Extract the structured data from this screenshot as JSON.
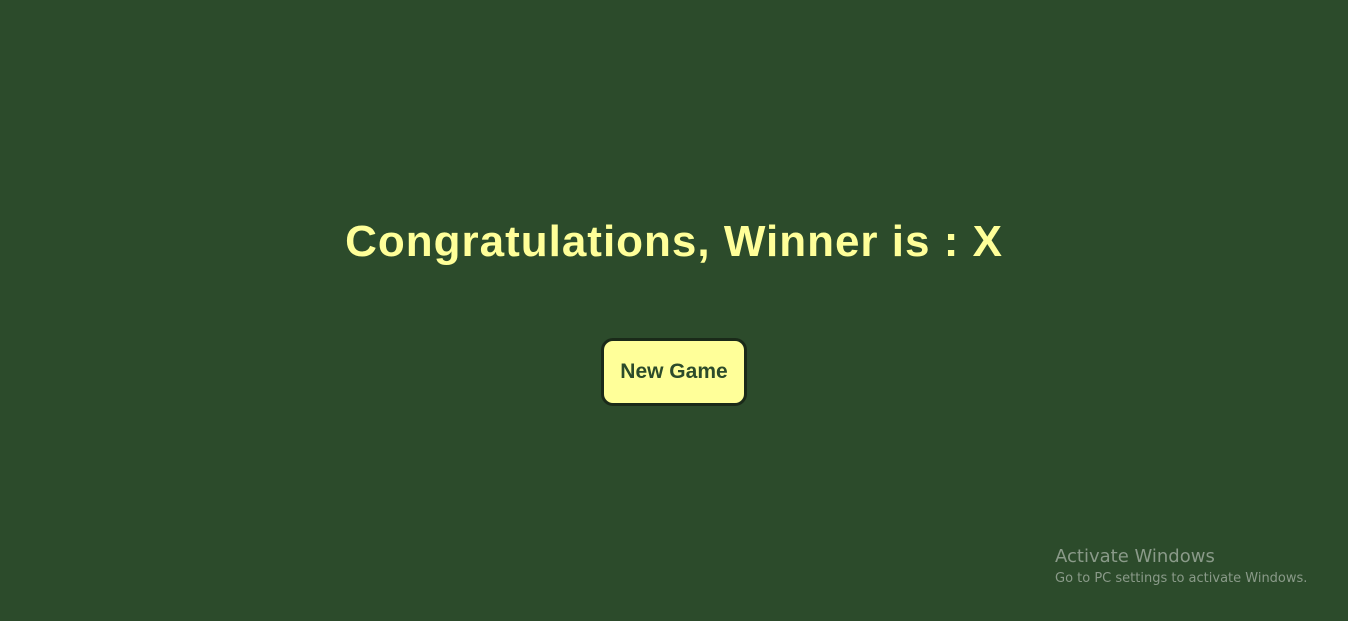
{
  "colors": {
    "background": "#2c4b2b",
    "accent": "#ffff99",
    "button_border": "#1a2a19",
    "watermark_text": "#8a9a89"
  },
  "game": {
    "winner_message": "Congratulations, Winner is : X",
    "new_game_label": "New Game"
  },
  "watermark": {
    "title": "Activate Windows",
    "subtitle": "Go to PC settings to activate Windows."
  }
}
